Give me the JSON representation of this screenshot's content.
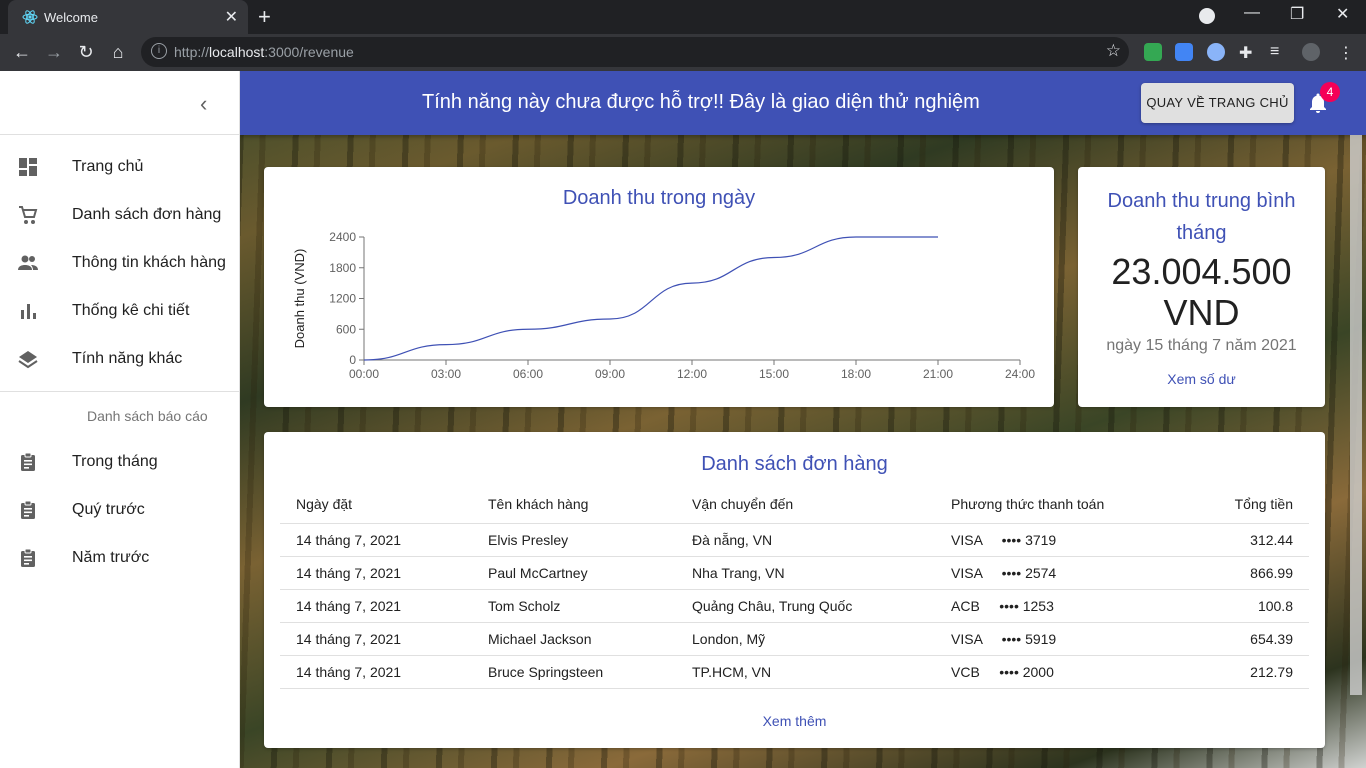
{
  "browser": {
    "tab_title": "Welcome",
    "url_prefix": "http://",
    "url_host": "localhost",
    "url_path": ":3000/revenue"
  },
  "sidebar": {
    "items": [
      {
        "label": "Trang chủ",
        "icon": "dashboard-icon"
      },
      {
        "label": "Danh sách đơn hàng",
        "icon": "cart-icon"
      },
      {
        "label": "Thông tin khách hàng",
        "icon": "people-icon"
      },
      {
        "label": "Thống kê chi tiết",
        "icon": "bar-chart-icon"
      },
      {
        "label": "Tính năng khác",
        "icon": "layers-icon"
      }
    ],
    "subheader": "Danh sách báo cáo",
    "reports": [
      {
        "label": "Trong tháng",
        "icon": "assignment-icon"
      },
      {
        "label": "Quý trước",
        "icon": "assignment-icon"
      },
      {
        "label": "Năm trước",
        "icon": "assignment-icon"
      }
    ]
  },
  "appbar": {
    "title": "Tính năng này chưa được hỗ trợ!! Đây là giao diện thử nghiệm",
    "home_button": "QUAY VỀ TRANG CHỦ",
    "notification_count": "4",
    "color": "#3f51b5"
  },
  "revenue_chart": {
    "title": "Doanh thu trong ngày"
  },
  "chart_data": {
    "type": "line",
    "title": "Doanh thu trong ngày",
    "xlabel": "",
    "ylabel": "Doanh thu (VND)",
    "x": [
      "00:00",
      "03:00",
      "06:00",
      "09:00",
      "12:00",
      "15:00",
      "18:00",
      "21:00"
    ],
    "values": [
      0,
      300,
      600,
      800,
      1500,
      2000,
      2400,
      2400
    ],
    "x_ticks": [
      "00:00",
      "03:00",
      "06:00",
      "09:00",
      "12:00",
      "15:00",
      "18:00",
      "21:00",
      "24:00"
    ],
    "y_ticks": [
      "0",
      "600",
      "1200",
      "1800",
      "2400"
    ],
    "ylim": [
      0,
      2400
    ],
    "line_color": "#3f51b5"
  },
  "average": {
    "title": "Doanh thu trung bình tháng",
    "amount": "23.004.500 VND",
    "date": "ngày 15 tháng 7 năm 2021",
    "link": "Xem số dư"
  },
  "orders": {
    "title": "Danh sách đơn hàng",
    "columns": [
      "Ngày đặt",
      "Tên khách hàng",
      "Vận chuyển đến",
      "Phương thức thanh toán",
      "Tổng tiền"
    ],
    "rows": [
      {
        "date": "14 tháng 7, 2021",
        "name": "Elvis Presley",
        "ship": "Đà nẵng, VN",
        "pay": "VISA     •••• 3719",
        "total": "312.44"
      },
      {
        "date": "14 tháng 7, 2021",
        "name": "Paul McCartney",
        "ship": "Nha Trang, VN",
        "pay": "VISA     •••• 2574",
        "total": "866.99"
      },
      {
        "date": "14 tháng 7, 2021",
        "name": "Tom Scholz",
        "ship": "Quảng Châu, Trung Quốc",
        "pay": "ACB     •••• 1253",
        "total": "100.8"
      },
      {
        "date": "14 tháng 7, 2021",
        "name": "Michael Jackson",
        "ship": "London, Mỹ",
        "pay": "VISA     •••• 5919",
        "total": "654.39"
      },
      {
        "date": "14 tháng 7, 2021",
        "name": "Bruce Springsteen",
        "ship": "TP.HCM, VN",
        "pay": "VCB     •••• 2000",
        "total": "212.79"
      }
    ],
    "more_link": "Xem thêm"
  }
}
